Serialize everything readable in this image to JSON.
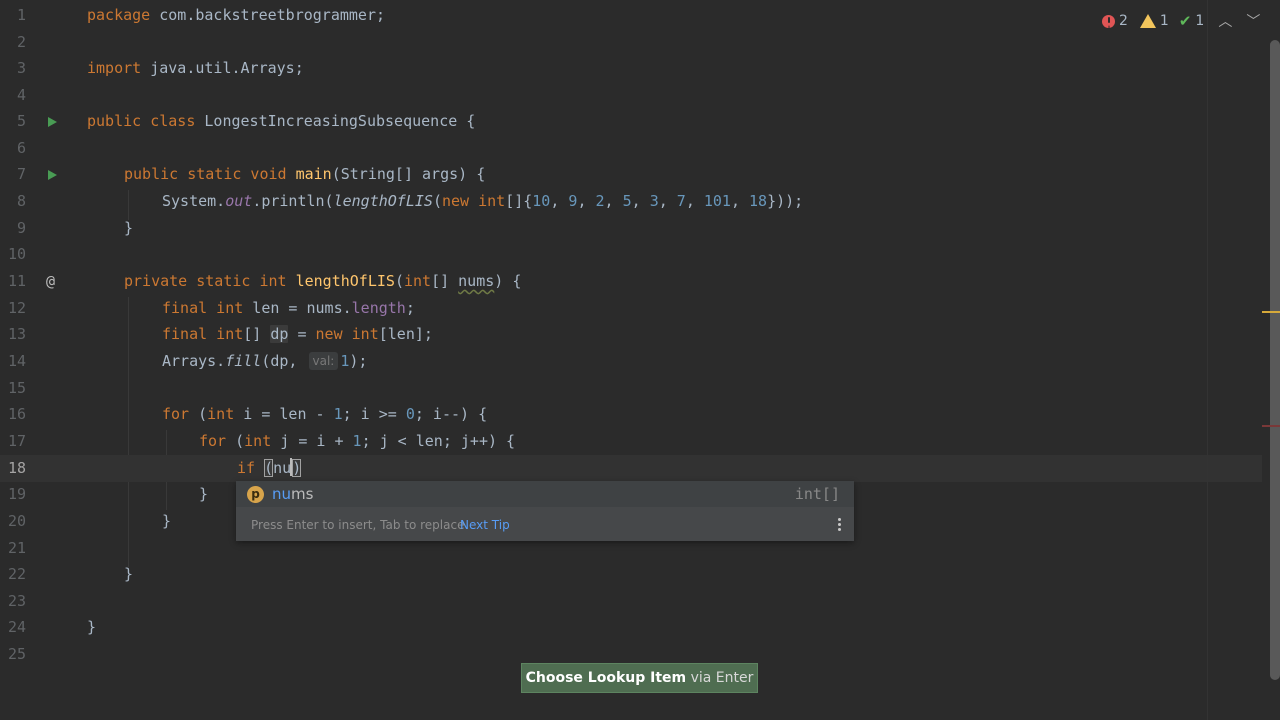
{
  "inspections": {
    "errors": "2",
    "warnings": "1",
    "ok": "1"
  },
  "lines": [
    "1",
    "2",
    "3",
    "4",
    "5",
    "6",
    "7",
    "8",
    "9",
    "10",
    "11",
    "12",
    "13",
    "14",
    "15",
    "16",
    "17",
    "18",
    "19",
    "20",
    "21",
    "22",
    "23",
    "24",
    "25"
  ],
  "code": {
    "l1_kw": "package",
    "l1_rest": " com.backstreetbrogrammer;",
    "l3_kw": "import",
    "l3_rest": " java.util.Arrays;",
    "l5_kw": "public class",
    "l5_rest": " LongestIncreasingSubsequence {",
    "l7_kw": "public static void",
    "l7_fn": " main",
    "l7_rest": "(String[] args) {",
    "l8_a": "System.",
    "l8_out": "out",
    "l8_b": ".println(",
    "l8_call": "lengthOfLIS",
    "l8_c": "(",
    "l8_new": "new int",
    "l8_d": "[]{",
    "l8_nums": [
      "10",
      "9",
      "2",
      "5",
      "3",
      "7",
      "101",
      "18"
    ],
    "l8_e": "}));",
    "l9": "}",
    "l11_kw": "private static int",
    "l11_fn": " lengthOfLIS",
    "l11_a": "(",
    "l11_int": "int",
    "l11_b": "[] ",
    "l11_param": "nums",
    "l11_c": ") {",
    "l12_kw": "final int",
    "l12_a": " len = nums.",
    "l12_fld": "length",
    "l12_b": ";",
    "l13_kw": "final int",
    "l13_a": "[] ",
    "l13_dp": "dp",
    "l13_b": " = ",
    "l13_new": "new int",
    "l13_c": "[len];",
    "l14_a": "Arrays.",
    "l14_fill": "fill",
    "l14_b": "(dp, ",
    "l14_hint": "val:",
    "l14_num": "1",
    "l14_c": ");",
    "l16_kw": "for",
    "l16_a": " (",
    "l16_int": "int",
    "l16_b": " i = len - ",
    "l16_n1": "1",
    "l16_c": "; i >= ",
    "l16_n0": "0",
    "l16_d": "; i--) {",
    "l17_kw": "for",
    "l17_a": " (",
    "l17_int": "int",
    "l17_b": " j = i + ",
    "l17_n1": "1",
    "l17_c": "; j < len; j++) {",
    "l18_kw": "if",
    "l18_a": " ",
    "l18_paren": "(",
    "l18_typed": "nu",
    "l18_close": ")",
    "l19": "}",
    "l20": "}",
    "l22": "}",
    "l24": "}"
  },
  "completion": {
    "badge": "p",
    "match": "nu",
    "rest": "ms",
    "type": "int[]",
    "footer_text": "Press Enter to insert, Tab to replace",
    "footer_link": "Next Tip"
  },
  "toast": {
    "action": "Choose Lookup Item",
    "via": "via Enter"
  },
  "colors": {
    "background": "#2b2b2b",
    "keyword": "#cc7832",
    "number": "#6897bb",
    "method": "#ffc66d",
    "field": "#9876aa"
  }
}
